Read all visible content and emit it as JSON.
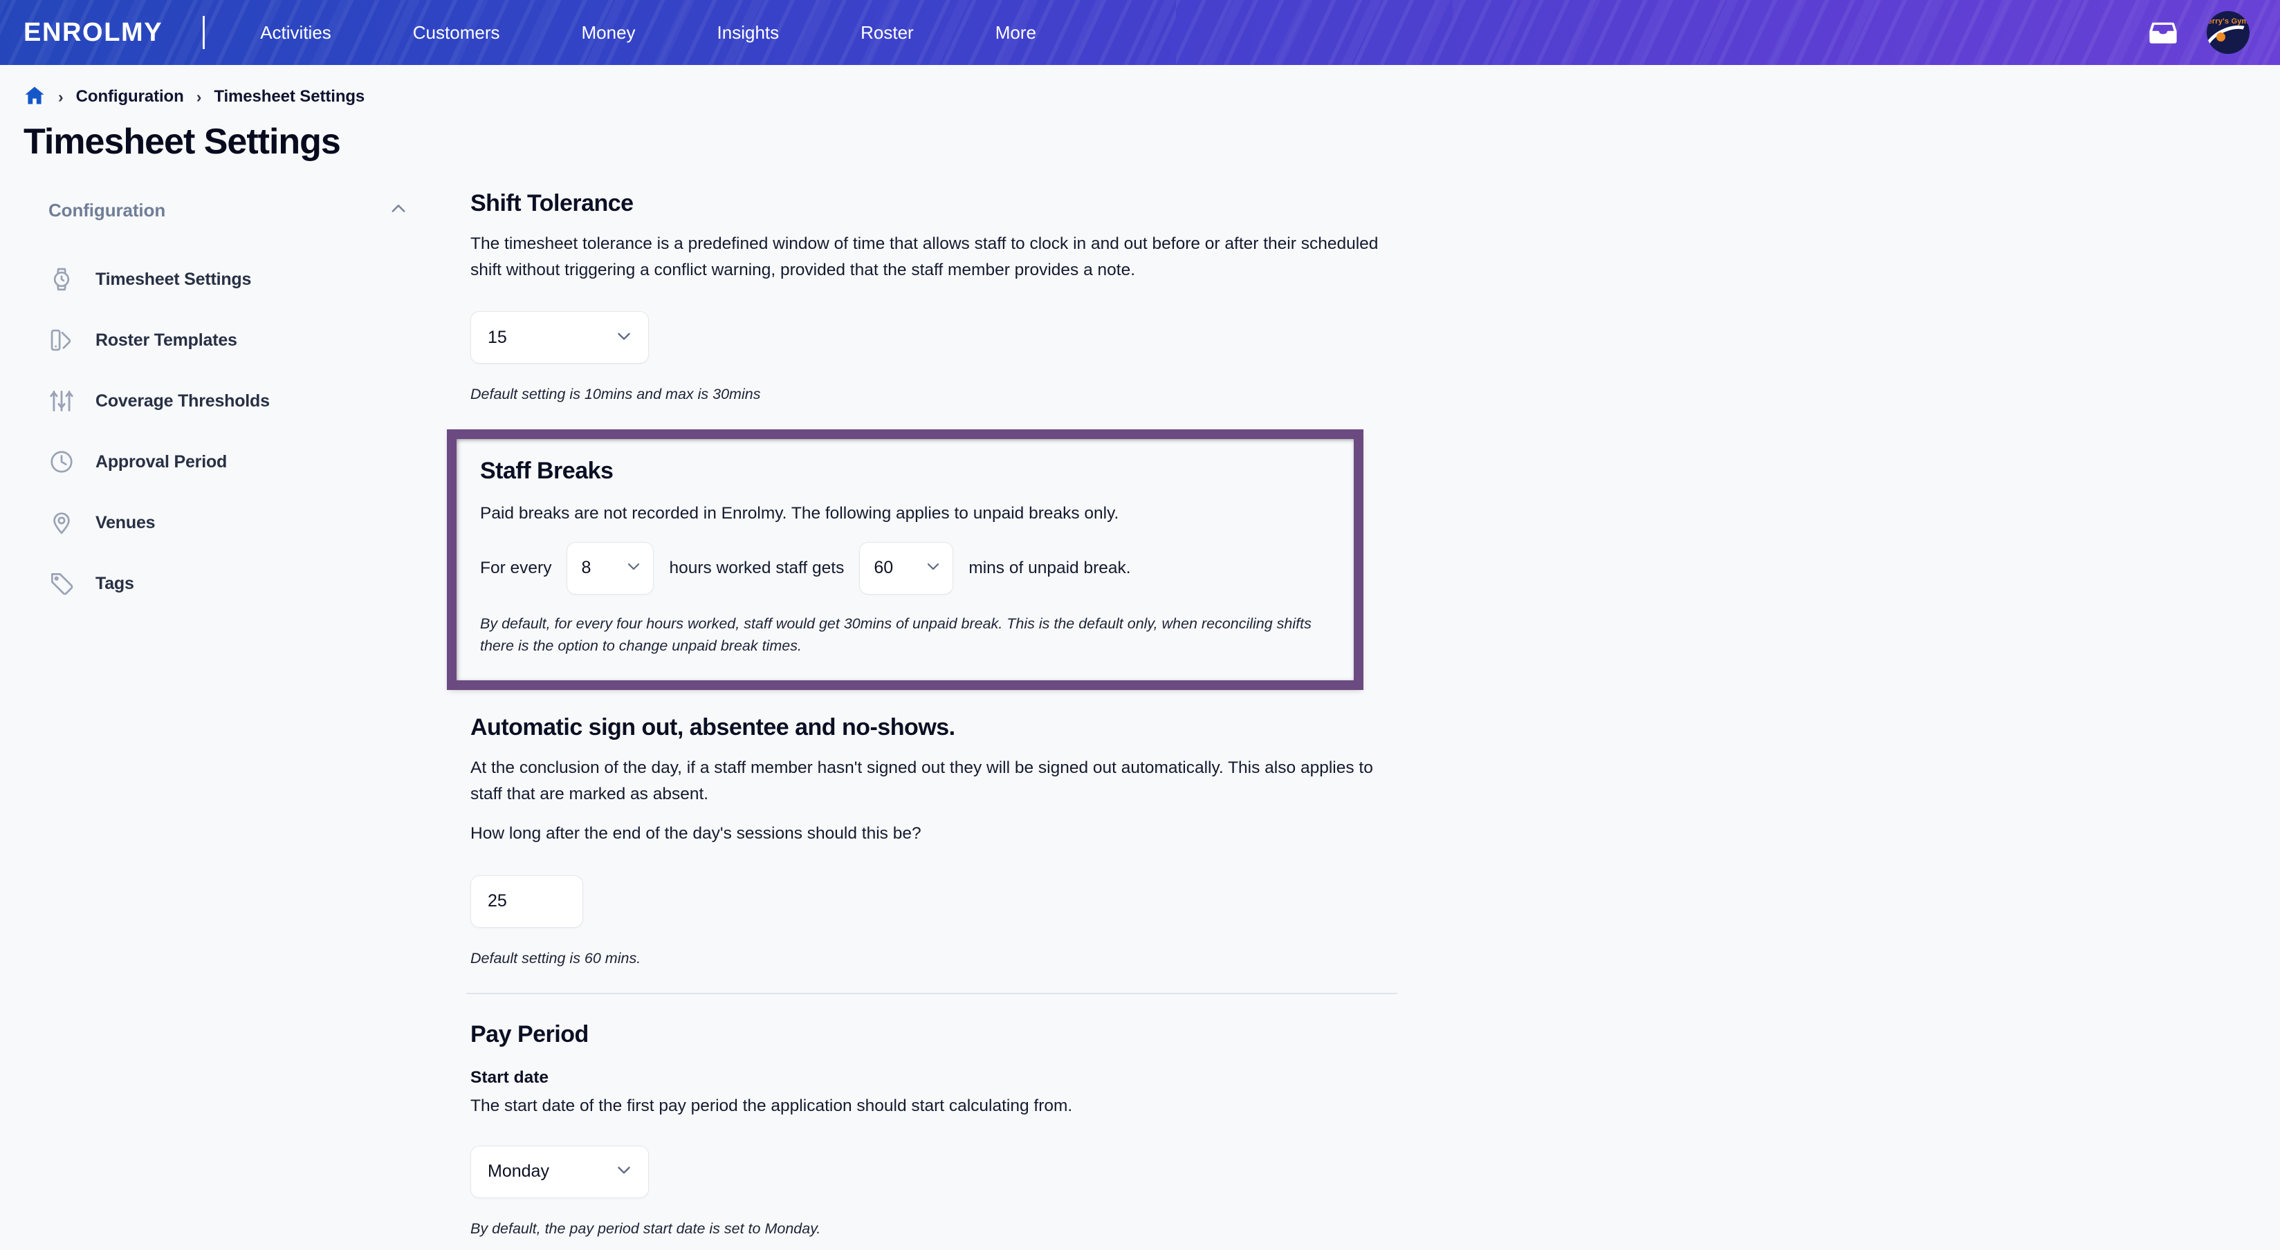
{
  "brand": {
    "name": "ENROLMY"
  },
  "nav": {
    "items": [
      {
        "label": "Activities"
      },
      {
        "label": "Customers"
      },
      {
        "label": "Money"
      },
      {
        "label": "Insights"
      },
      {
        "label": "Roster"
      },
      {
        "label": "More"
      }
    ],
    "inbox_icon": "inbox-icon",
    "avatar_text": "erry's Gym"
  },
  "breadcrumb": {
    "home_icon": "home-icon",
    "separator": "›",
    "items": [
      {
        "label": "Configuration"
      },
      {
        "label": "Timesheet Settings"
      }
    ]
  },
  "page": {
    "title": "Timesheet Settings"
  },
  "sidebar": {
    "group_label": "Configuration",
    "collapse_icon": "chevron-up-icon",
    "items": [
      {
        "label": "Timesheet Settings",
        "icon": "watch-icon"
      },
      {
        "label": "Roster Templates",
        "icon": "template-icon"
      },
      {
        "label": "Coverage Thresholds",
        "icon": "sliders-icon"
      },
      {
        "label": "Approval Period",
        "icon": "clock-icon"
      },
      {
        "label": "Venues",
        "icon": "map-pin-icon"
      },
      {
        "label": "Tags",
        "icon": "tag-icon"
      }
    ]
  },
  "shift_tolerance": {
    "title": "Shift Tolerance",
    "description": "The timesheet tolerance is a predefined window of time that allows staff to clock in and out before or after their scheduled shift without triggering a conflict warning, provided that the staff member provides a note.",
    "select_value": "15",
    "hint": "Default setting is 10mins and max is 30mins"
  },
  "staff_breaks": {
    "title": "Staff Breaks",
    "description": "Paid breaks are not recorded in Enrolmy. The following applies to unpaid breaks only.",
    "prefix_text": "For every",
    "hours_value": "8",
    "middle_text": "hours worked staff gets",
    "mins_value": "60",
    "suffix_text": "mins of unpaid break.",
    "hint": "By default, for every four hours worked, staff would get 30mins of unpaid break. This is the default only, when reconciling shifts there is the option to change unpaid break times.",
    "highlight_color": "#6b4a82"
  },
  "auto_signout": {
    "title": "Automatic sign out, absentee and no-shows.",
    "description": "At the conclusion of the day, if a staff member hasn't signed out they will be signed out automatically. This also applies to staff that are marked as absent.",
    "question": "How long after the end of the day's sessions should this be?",
    "input_value": "25",
    "hint": "Default setting is 60 mins."
  },
  "pay_period": {
    "title": "Pay Period",
    "subtitle": "Start date",
    "description": "The start date of the first pay period the application should start calculating from.",
    "select_value": "Monday",
    "hint": "By default, the pay period start date is set to Monday."
  }
}
